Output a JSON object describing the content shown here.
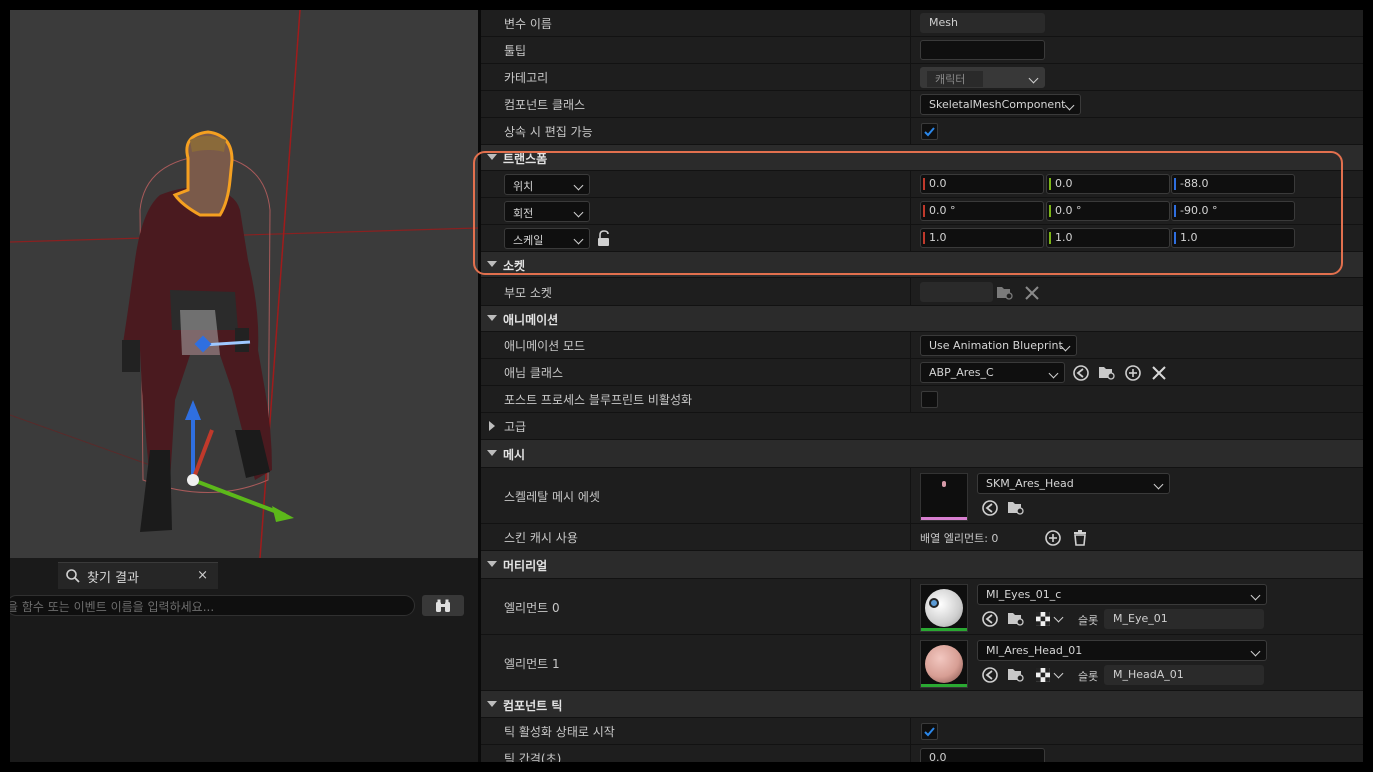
{
  "find": {
    "tab_label": "찾기 결과",
    "close_glyph": "×",
    "search_placeholder": "을 함수 또는 이벤트 이름을 입력하세요..."
  },
  "rows": {
    "variable_name": {
      "label": "변수 이름",
      "value": "Mesh"
    },
    "tooltip": {
      "label": "툴팁",
      "value": ""
    },
    "category": {
      "label": "카테고리",
      "value": "캐릭터"
    },
    "component_class": {
      "label": "컴포넌트 클래스",
      "value": "SkeletalMeshComponent"
    },
    "editable_on_inherit": {
      "label": "상속 시 편집 가능",
      "checked": true
    }
  },
  "transform": {
    "header": "트랜스폼",
    "location": {
      "mode": "위치",
      "x": "0.0",
      "y": "0.0",
      "z": "-88.0"
    },
    "rotation": {
      "mode": "회전",
      "x": "0.0 °",
      "y": "0.0 °",
      "z": "-90.0 °"
    },
    "scale": {
      "mode": "스케일",
      "x": "1.0",
      "y": "1.0",
      "z": "1.0"
    }
  },
  "socket": {
    "header": "소켓",
    "parent_socket_label": "부모 소켓",
    "parent_socket_value": ""
  },
  "animation": {
    "header": "애니메이션",
    "mode_label": "애니메이션 모드",
    "mode_value": "Use Animation Blueprint",
    "anim_class_label": "애님 클래스",
    "anim_class_value": "ABP_Ares_C",
    "disable_post_process_label": "포스트 프로세스 블루프린트 비활성화",
    "disable_post_process_checked": false
  },
  "advanced": {
    "header": "고급"
  },
  "mesh": {
    "header": "메시",
    "skeletal_mesh_label": "스켈레탈 메시 에셋",
    "skeletal_mesh_value": "SKM_Ares_Head",
    "skin_cache_label": "스킨 캐시 사용",
    "array_elements": "배열 엘리먼트: 0"
  },
  "materials": {
    "header": "머티리얼",
    "slot_label": "슬롯",
    "elements": [
      {
        "label": "엘리먼트 0",
        "material": "MI_Eyes_01_c",
        "slot": "M_Eye_01"
      },
      {
        "label": "엘리먼트 1",
        "material": "MI_Ares_Head_01",
        "slot": "M_HeadA_01"
      }
    ]
  },
  "component_tick": {
    "header": "컴포넌트 틱",
    "start_enabled_label": "틱 활성화 상태로 시작",
    "start_enabled_checked": true,
    "interval_label": "틱 간격(초)",
    "interval_value": "0.0"
  },
  "colors": {
    "highlight": "#e2704e",
    "axis_x": "#c0392b",
    "axis_y": "#7cb518",
    "axis_z": "#2f6fe0",
    "check_blue": "#2a86e8"
  }
}
